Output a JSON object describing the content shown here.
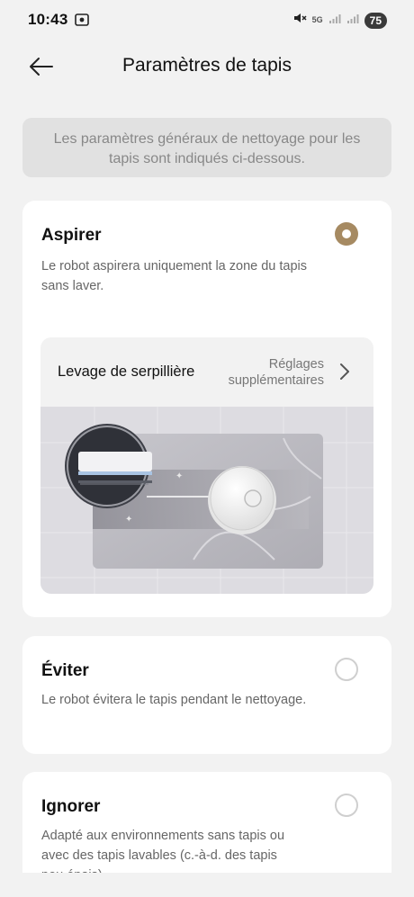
{
  "status_bar": {
    "time": "10:43",
    "network_label": "5G",
    "battery": "75",
    "icons": [
      "screen-record-icon",
      "mute-icon",
      "signal-icon",
      "signal-icon-2"
    ]
  },
  "header": {
    "title": "Paramètres de tapis",
    "back_icon": "arrow-left-icon"
  },
  "info_banner": {
    "text": "Les paramètres généraux de nettoyage pour les tapis sont indiqués ci-dessous."
  },
  "options": [
    {
      "title": "Aspirer",
      "description": "Le robot aspirera uniquement la zone du tapis sans laver.",
      "selected": true
    },
    {
      "title": "Éviter",
      "description": "Le robot évitera le tapis pendant le nettoyage.",
      "selected": false
    },
    {
      "title": "Ignorer",
      "description": "Adapté aux environnements sans tapis ou avec des tapis lavables (c.-à-d. des tapis peu épais).",
      "selected": false
    }
  ],
  "mop_lift": {
    "label": "Levage de serpillière",
    "extra_line1": "Réglages",
    "extra_line2": "supplémentaires",
    "chevron_icon": "chevron-right-icon"
  },
  "colors": {
    "accent": "#a68a62",
    "background": "#f2f2f2",
    "card": "#ffffff",
    "banner": "#e1e1e1"
  }
}
